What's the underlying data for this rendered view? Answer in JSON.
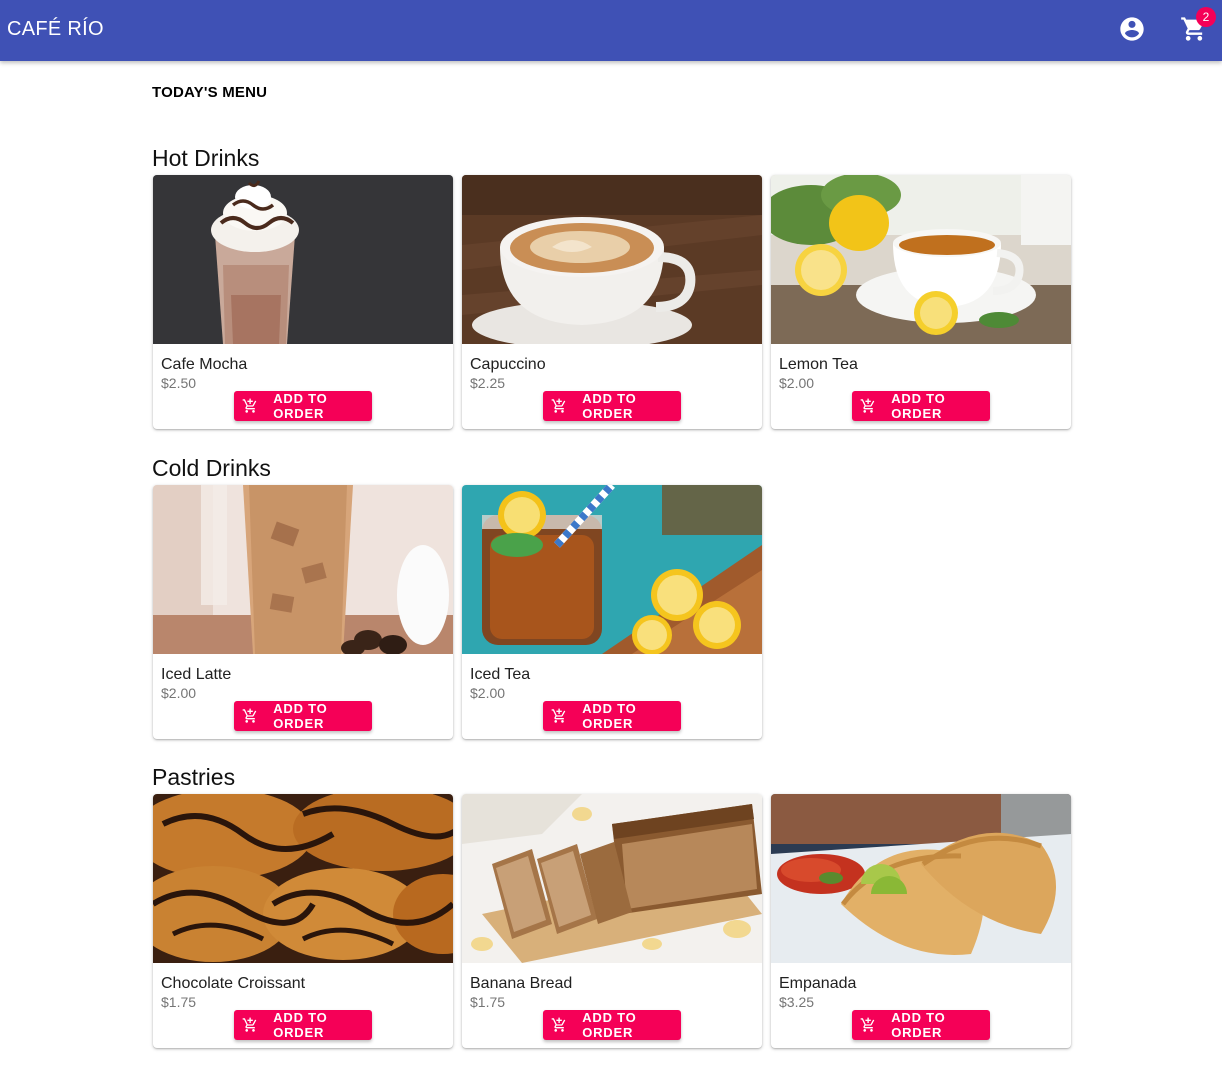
{
  "header": {
    "brand": "CAFÉ RÍO",
    "account_icon": "account-circle-icon",
    "cart_icon": "shopping-cart-icon",
    "cart_count": "2",
    "bar_color": "#3f51b5",
    "badge_color": "#f50057"
  },
  "page": {
    "heading": "TODAY'S MENU"
  },
  "add_button": {
    "label": "ADD TO ORDER",
    "icon": "add-shopping-cart-icon",
    "color": "#f50057"
  },
  "sections": [
    {
      "title": "Hot Drinks",
      "items": [
        {
          "name": "Cafe Mocha",
          "price": "$2.50"
        },
        {
          "name": "Capuccino",
          "price": "$2.25"
        },
        {
          "name": "Lemon Tea",
          "price": "$2.00"
        }
      ]
    },
    {
      "title": "Cold Drinks",
      "items": [
        {
          "name": "Iced Latte",
          "price": "$2.00"
        },
        {
          "name": "Iced Tea",
          "price": "$2.00"
        }
      ]
    },
    {
      "title": "Pastries",
      "items": [
        {
          "name": "Chocolate Croissant",
          "price": "$1.75"
        },
        {
          "name": "Banana Bread",
          "price": "$1.75"
        },
        {
          "name": "Empanada",
          "price": "$3.25"
        }
      ]
    }
  ]
}
